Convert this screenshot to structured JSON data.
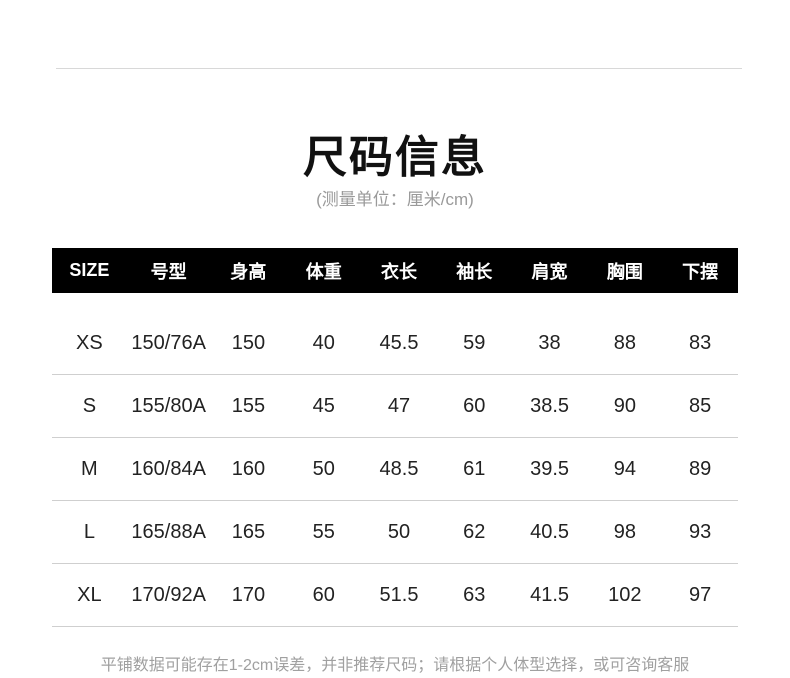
{
  "title": "尺码信息",
  "subtitle": "(测量单位：厘米/cm)",
  "table": {
    "headers": [
      "SIZE",
      "号型",
      "身高",
      "体重",
      "衣长",
      "袖长",
      "肩宽",
      "胸围",
      "下摆"
    ],
    "rows": [
      [
        "XS",
        "150/76A",
        "150",
        "40",
        "45.5",
        "59",
        "38",
        "88",
        "83"
      ],
      [
        "S",
        "155/80A",
        "155",
        "45",
        "47",
        "60",
        "38.5",
        "90",
        "85"
      ],
      [
        "M",
        "160/84A",
        "160",
        "50",
        "48.5",
        "61",
        "39.5",
        "94",
        "89"
      ],
      [
        "L",
        "165/88A",
        "165",
        "55",
        "50",
        "62",
        "40.5",
        "98",
        "93"
      ],
      [
        "XL",
        "170/92A",
        "170",
        "60",
        "51.5",
        "63",
        "41.5",
        "102",
        "97"
      ]
    ]
  },
  "footnote": "平铺数据可能存在1-2cm误差，并非推荐尺码；请根据个人体型选择，或可咨询客服",
  "colors": {
    "header_bg": "#000000",
    "header_text": "#ffffff",
    "subtitle_text": "#9a9a9a",
    "footnote_text": "#a0a0a0"
  }
}
